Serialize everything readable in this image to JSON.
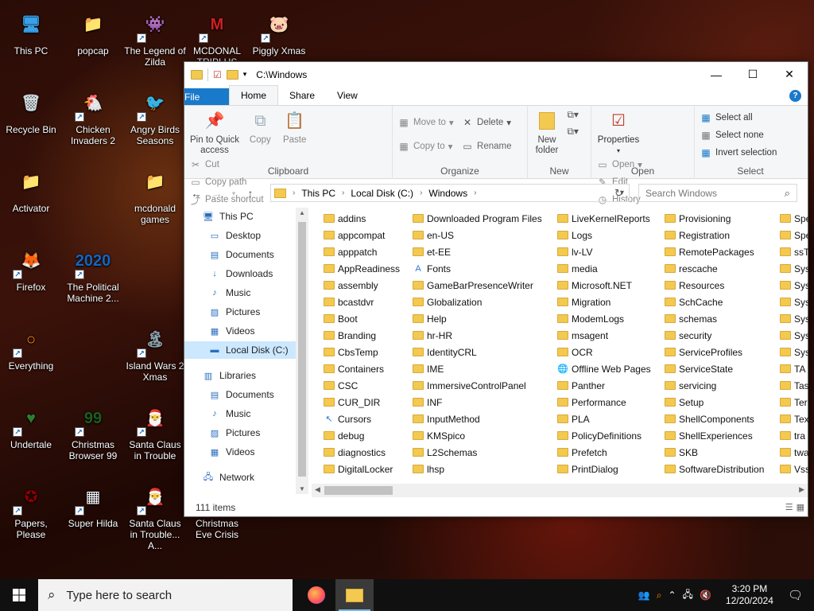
{
  "desktop": {
    "icons": [
      {
        "label": "This PC",
        "glyph": "🖥",
        "color": "#3aa0e8"
      },
      {
        "label": "popcap",
        "glyph": "📁",
        "color": "#f3c94f"
      },
      {
        "label": "The Legend of Zilda",
        "glyph": "👾",
        "color": "#4caf50"
      },
      {
        "label": "MCDONAL TRIPLUS",
        "glyph": "M",
        "color": "#d21f1f"
      },
      {
        "label": "Piggly Xmas",
        "glyph": "🐷",
        "color": "#e27ac0"
      },
      {
        "label": "Recycle Bin",
        "glyph": "🗑",
        "color": "#cfd8dc"
      },
      {
        "label": "Chicken Invaders 2",
        "glyph": "🐔",
        "color": "#eeeeee"
      },
      {
        "label": "Angry Birds Seasons",
        "glyph": "🐦",
        "color": "#c62828"
      },
      {
        "label": "Activator",
        "glyph": "📁",
        "color": "#f3c94f"
      },
      {
        "label": "mcdonald games",
        "glyph": "📁",
        "color": "#f3c94f"
      },
      {
        "label": "Firefox",
        "glyph": "🦊",
        "color": "#ff7139"
      },
      {
        "label": "The Political Machine 2...",
        "glyph": "2020",
        "color": "#1565c0"
      },
      {
        "label": "Everything",
        "glyph": "○",
        "color": "#ff8f00"
      },
      {
        "label": "Island Wars 2 Xmas",
        "glyph": "🏝",
        "color": "#90a4ae"
      },
      {
        "label": "Undertale",
        "glyph": "♥",
        "color": "#2e7d32"
      },
      {
        "label": "Christmas Browser 99",
        "glyph": "99",
        "color": "#1b5e20"
      },
      {
        "label": "Santa Claus in Trouble",
        "glyph": "🎅",
        "color": "#b71c1c"
      },
      {
        "label": "Papers, Please",
        "glyph": "✪",
        "color": "#8b0000"
      },
      {
        "label": "Super Hilda",
        "glyph": "▦",
        "color": "#fafafa"
      },
      {
        "label": "Santa Claus in Trouble... A...",
        "glyph": "🎅",
        "color": "#c62828"
      },
      {
        "label": "Christmas Eve Crisis",
        "glyph": "",
        "color": ""
      }
    ]
  },
  "explorer": {
    "title": "C:\\Windows",
    "tabs": {
      "file": "File",
      "home": "Home",
      "share": "Share",
      "view": "View"
    },
    "ribbon": {
      "clipboard": {
        "label": "Clipboard",
        "pin": "Pin to Quick access",
        "copy": "Copy",
        "paste": "Paste",
        "cut": "Cut",
        "copy_path": "Copy path",
        "paste_shortcut": "Paste shortcut"
      },
      "organize": {
        "label": "Organize",
        "move_to": "Move to",
        "copy_to": "Copy to",
        "delete": "Delete",
        "rename": "Rename"
      },
      "new": {
        "label": "New",
        "new_folder": "New folder"
      },
      "open": {
        "label": "Open",
        "properties": "Properties",
        "open": "Open",
        "edit": "Edit",
        "history": "History"
      },
      "select": {
        "label": "Select",
        "select_all": "Select all",
        "select_none": "Select none",
        "invert": "Invert selection"
      }
    },
    "address": {
      "crumbs": [
        "This PC",
        "Local Disk (C:)",
        "Windows"
      ],
      "search_placeholder": "Search Windows"
    },
    "tree": [
      {
        "label": "This PC",
        "icon": "pc-icon",
        "glyph": "🖥",
        "indent": 0
      },
      {
        "label": "Desktop",
        "icon": "desktop-icon",
        "glyph": "▭",
        "indent": 1
      },
      {
        "label": "Documents",
        "icon": "documents-icon",
        "glyph": "▤",
        "indent": 1
      },
      {
        "label": "Downloads",
        "icon": "downloads-icon",
        "glyph": "↓",
        "indent": 1
      },
      {
        "label": "Music",
        "icon": "music-icon",
        "glyph": "♪",
        "indent": 1
      },
      {
        "label": "Pictures",
        "icon": "pictures-icon",
        "glyph": "▨",
        "indent": 1
      },
      {
        "label": "Videos",
        "icon": "videos-icon",
        "glyph": "▦",
        "indent": 1
      },
      {
        "label": "Local Disk (C:)",
        "icon": "disk-icon",
        "glyph": "▬",
        "indent": 1,
        "selected": true
      },
      {
        "label": "Libraries",
        "icon": "libraries-icon",
        "glyph": "▥",
        "indent": 0
      },
      {
        "label": "Documents",
        "icon": "documents-icon",
        "glyph": "▤",
        "indent": 1
      },
      {
        "label": "Music",
        "icon": "music-icon",
        "glyph": "♪",
        "indent": 1
      },
      {
        "label": "Pictures",
        "icon": "pictures-icon",
        "glyph": "▨",
        "indent": 1
      },
      {
        "label": "Videos",
        "icon": "videos-icon",
        "glyph": "▦",
        "indent": 1
      },
      {
        "label": "Network",
        "icon": "network-icon",
        "glyph": "🖧",
        "indent": 0
      }
    ],
    "columns": [
      [
        "addins",
        "appcompat",
        "apppatch",
        "AppReadiness",
        "assembly",
        "bcastdvr",
        "Boot",
        "Branding",
        "CbsTemp",
        "Containers",
        "CSC",
        "CUR_DIR",
        "Cursors",
        "debug",
        "diagnostics",
        "DigitalLocker"
      ],
      [
        "Downloaded Program Files",
        "en-US",
        "et-EE",
        "Fonts",
        "GameBarPresenceWriter",
        "Globalization",
        "Help",
        "hr-HR",
        "IdentityCRL",
        "IME",
        "ImmersiveControlPanel",
        "INF",
        "InputMethod",
        "KMSpico",
        "L2Schemas",
        "lhsp"
      ],
      [
        "LiveKernelReports",
        "Logs",
        "lv-LV",
        "media",
        "Microsoft.NET",
        "Migration",
        "ModemLogs",
        "msagent",
        "OCR",
        "Offline Web Pages",
        "Panther",
        "Performance",
        "PLA",
        "PolicyDefinitions",
        "Prefetch",
        "PrintDialog"
      ],
      [
        "Provisioning",
        "Registration",
        "RemotePackages",
        "rescache",
        "Resources",
        "SchCache",
        "schemas",
        "security",
        "ServiceProfiles",
        "ServiceState",
        "servicing",
        "Setup",
        "ShellComponents",
        "ShellExperiences",
        "SKB",
        "SoftwareDistribution"
      ],
      [
        "Spe",
        "Spe",
        "ssT",
        "Sys",
        "Sys",
        "Sys",
        "Sys",
        "Sys",
        "Sys",
        "TA",
        "Tas",
        "Ter",
        "Tex",
        "tra",
        "twa",
        "Vss"
      ]
    ],
    "special_files": {
      "Fonts": "A",
      "Cursors": "↖",
      "Offline Web Pages": "🌐"
    },
    "status": "111 items"
  },
  "taskbar": {
    "search_placeholder": "Type here to search",
    "time": "3:20 PM",
    "date": "12/20/2024"
  },
  "colors": {
    "accent": "#1979ca",
    "selection": "#cce8ff",
    "folder": "#f3c94f"
  }
}
